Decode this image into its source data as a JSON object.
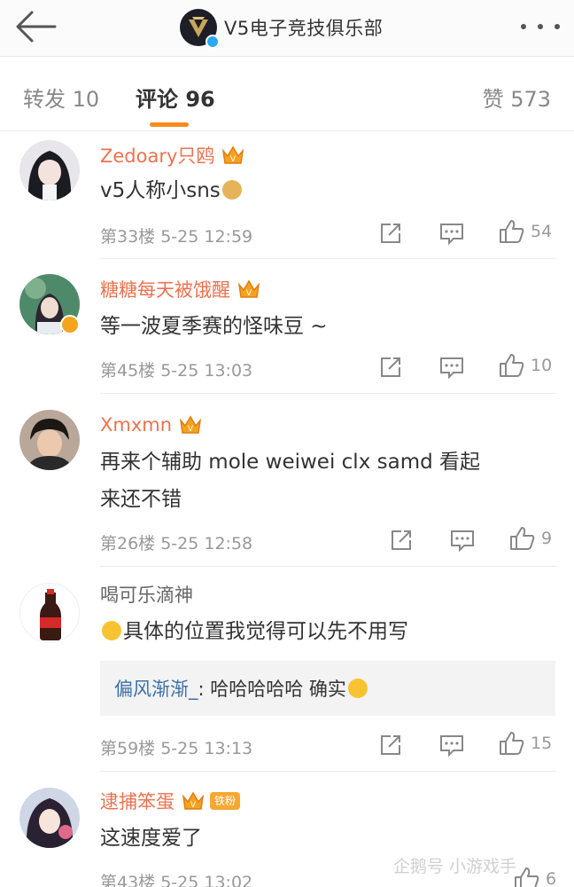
{
  "header": {
    "title": "V5电子竞技俱乐部"
  },
  "tabs": {
    "repost": "转发 10",
    "comment": "评论 96",
    "likes": "赞 573"
  },
  "comments": [
    {
      "user": "Zedoary只鸥",
      "text": "v5人称小sns",
      "meta": "第33楼  5-25 12:59",
      "likes": "54"
    },
    {
      "user": "糖糖每天被饿醒",
      "text": "等一波夏季赛的怪味豆 ~",
      "meta": "第45楼  5-25 13:03",
      "likes": "10"
    },
    {
      "user": "Xmxmn",
      "text_line1": "再来个辅助 mole weiwei clx samd 看起",
      "text_line2": "来还不错",
      "meta": "第26楼  5-25 12:58",
      "likes": "9"
    },
    {
      "user": "喝可乐滴神",
      "text": "具体的位置我觉得可以先不用写",
      "reply_user": "偏风渐渐_",
      "reply_text": ": 哈哈哈哈哈 确实",
      "meta": "第59楼  5-25 13:13",
      "likes": "15"
    },
    {
      "user": "逮捕笨蛋",
      "fan_badge": "铁粉",
      "text": "这速度爱了",
      "meta": "第43楼  5-25 13:02",
      "likes": "6"
    }
  ],
  "watermark": "企鹅号 小游戏手",
  "colors": {
    "accent": "#f98a1f",
    "username": "#eb7350",
    "reply_user": "#3b70a8",
    "verified": "#2aa9f0"
  }
}
